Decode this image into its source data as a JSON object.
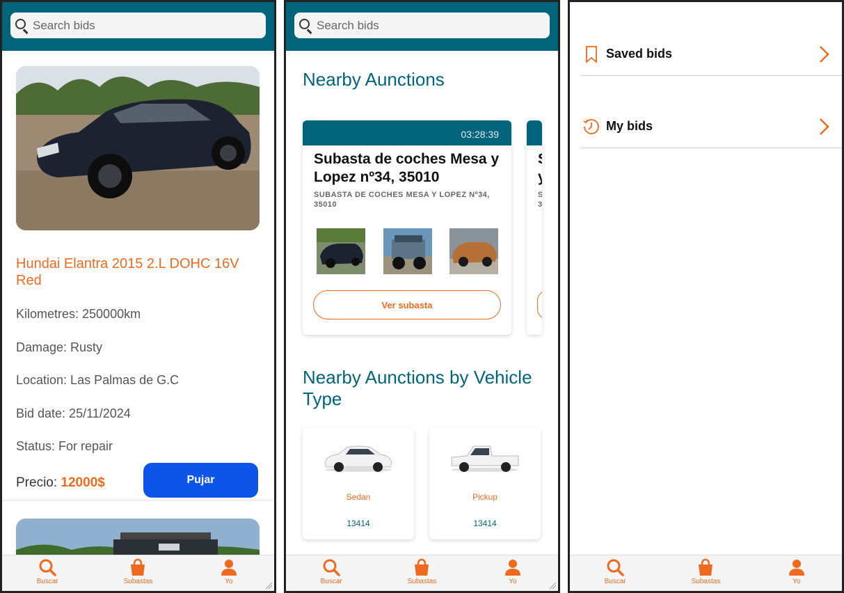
{
  "colors": {
    "teal": "#00657a",
    "orange": "#ee6a1f",
    "blue": "#0c55e8"
  },
  "search": {
    "placeholder": "Search bids"
  },
  "nav": {
    "buscar": "Buscar",
    "subastas": "Subastas",
    "yo": "Yo"
  },
  "listing": {
    "title": "Hundai Elantra 2015 2.L DOHC 16V Red",
    "kilometres": "Kilometres: 250000km",
    "damage": "Damage: Rusty",
    "location": "Location: Las Palmas de G.C",
    "bid_date": "Bid date: 25/11/2024",
    "status": "Status: For repair",
    "price_label": "Precio: ",
    "price_value": "12000$",
    "bid_button": "Pujar"
  },
  "auctions": {
    "nearby_title": "Nearby Aunctions",
    "card": {
      "timer": "03:28:39",
      "title": "Subasta de coches Mesa y Lopez nº34, 35010",
      "subtitle": "SUBASTA DE COCHES MESA Y LOPEZ Nº34, 35010",
      "button": "Ver subasta"
    },
    "next_card": {
      "title": "S y",
      "subtitle": "S 3"
    },
    "by_type_title": "Nearby Aunctions by Vehicle Type",
    "types": [
      {
        "name": "Sedan",
        "count": "13414"
      },
      {
        "name": "Pickup",
        "count": "13414"
      }
    ]
  },
  "profile": {
    "items": [
      {
        "label": "Saved bids",
        "icon": "bookmark-icon"
      },
      {
        "label": "My bids",
        "icon": "history-clock-icon"
      }
    ]
  }
}
